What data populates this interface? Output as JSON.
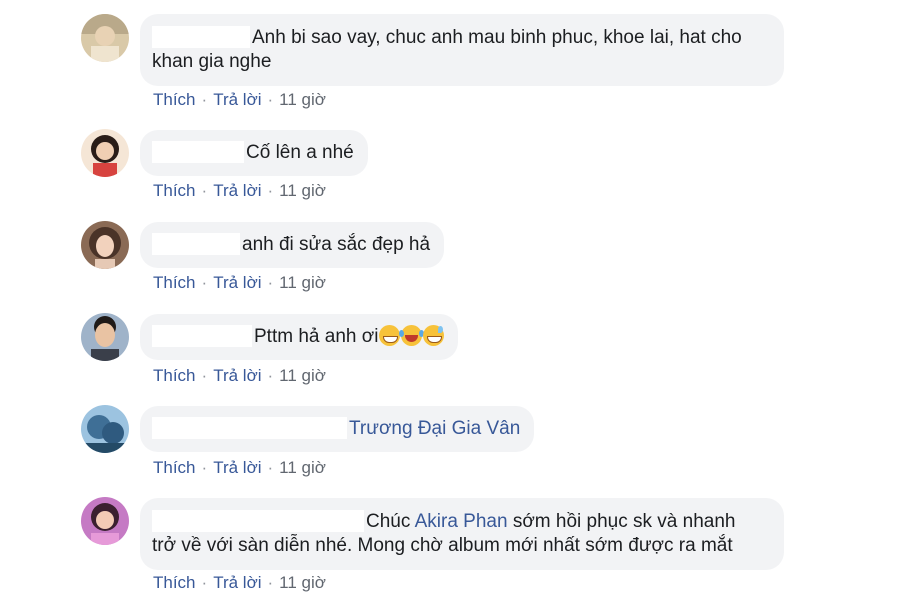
{
  "comments": [
    {
      "avatar": "user-avatar-1",
      "text": "Anh bi sao vay, chuc anh mau binh phuc, khoe lai, hat cho khan gia nghe",
      "like": "Thích",
      "reply": "Trả lời",
      "time": "11 giờ"
    },
    {
      "avatar": "user-avatar-2",
      "text": "Cố lên a nhé",
      "like": "Thích",
      "reply": "Trả lời",
      "time": "11 giờ"
    },
    {
      "avatar": "user-avatar-3",
      "text": "anh đi sửa sắc đẹp hả",
      "like": "Thích",
      "reply": "Trả lời",
      "time": "11 giờ"
    },
    {
      "avatar": "user-avatar-4",
      "text": "Pttm hả anh ơi",
      "emojis": [
        "grinning-face-emoji",
        "tears-of-joy-emoji",
        "sweat-smile-emoji"
      ],
      "like": "Thích",
      "reply": "Trả lời",
      "time": "11 giờ"
    },
    {
      "avatar": "user-avatar-5",
      "mention": "Trương Đại Gia Vân",
      "like": "Thích",
      "reply": "Trả lời",
      "time": "11 giờ"
    },
    {
      "avatar": "user-avatar-6",
      "text_before": "Chúc",
      "mention": "Akira Phan",
      "text_after_line1": "sớm hồi phục sk và nhanh",
      "text_line2": "trở về với sàn diễn nhé. Mong chờ album mới nhất sớm được ra mắt",
      "like": "Thích",
      "reply": "Trả lời",
      "time": "11 giờ"
    }
  ],
  "separator": "·",
  "colors": {
    "bubble": "#f2f3f5",
    "link": "#385898",
    "text": "#1c1e21",
    "meta": "#616770"
  }
}
